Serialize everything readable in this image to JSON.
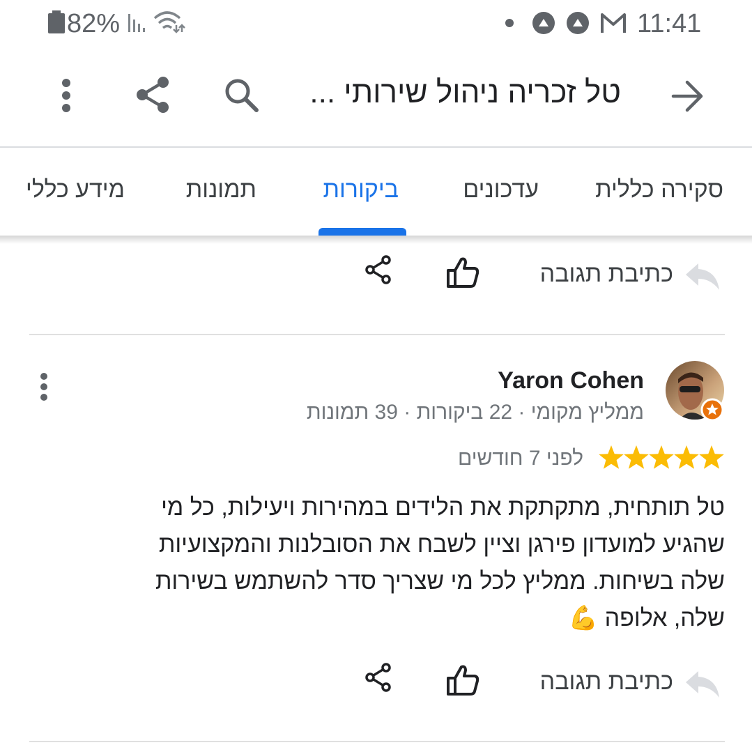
{
  "status_bar": {
    "battery": "82%",
    "time": "11:41"
  },
  "app_bar": {
    "title": "טל זכריה ניהול שירותי ...",
    "icons": [
      "back-arrow-icon",
      "search-icon",
      "share-icon",
      "more-vert-icon"
    ]
  },
  "tabs": [
    {
      "label": "סקירה כללית",
      "active": false
    },
    {
      "label": "עדכונים",
      "active": false
    },
    {
      "label": "ביקורות",
      "active": true
    },
    {
      "label": "תמונות",
      "active": false
    },
    {
      "label": "מידע כללי",
      "active": false
    }
  ],
  "actions": {
    "reply_label": "כתיבת תגובה"
  },
  "review": {
    "name": "Yaron Cohen",
    "meta": "ממליץ מקומי · 22 ביקורות · 39 תמונות",
    "rating": 5,
    "date": "לפני 7 חודשים",
    "lines": [
      "טל תותחית, מתקתקת את הלידים במהירות ויעילות, כל מי",
      "שהגיע למועדון פירגן וציין לשבח את הסובלנות והמקצועיות",
      "שלה בשיחות. ממליץ לכל מי שצריך סדר להשתמש בשירות",
      "שלה, אלופה"
    ],
    "emoji": "💪"
  },
  "colors": {
    "accent": "#1a73e8",
    "star": "#fbbc04",
    "badge": "#e8710a"
  }
}
